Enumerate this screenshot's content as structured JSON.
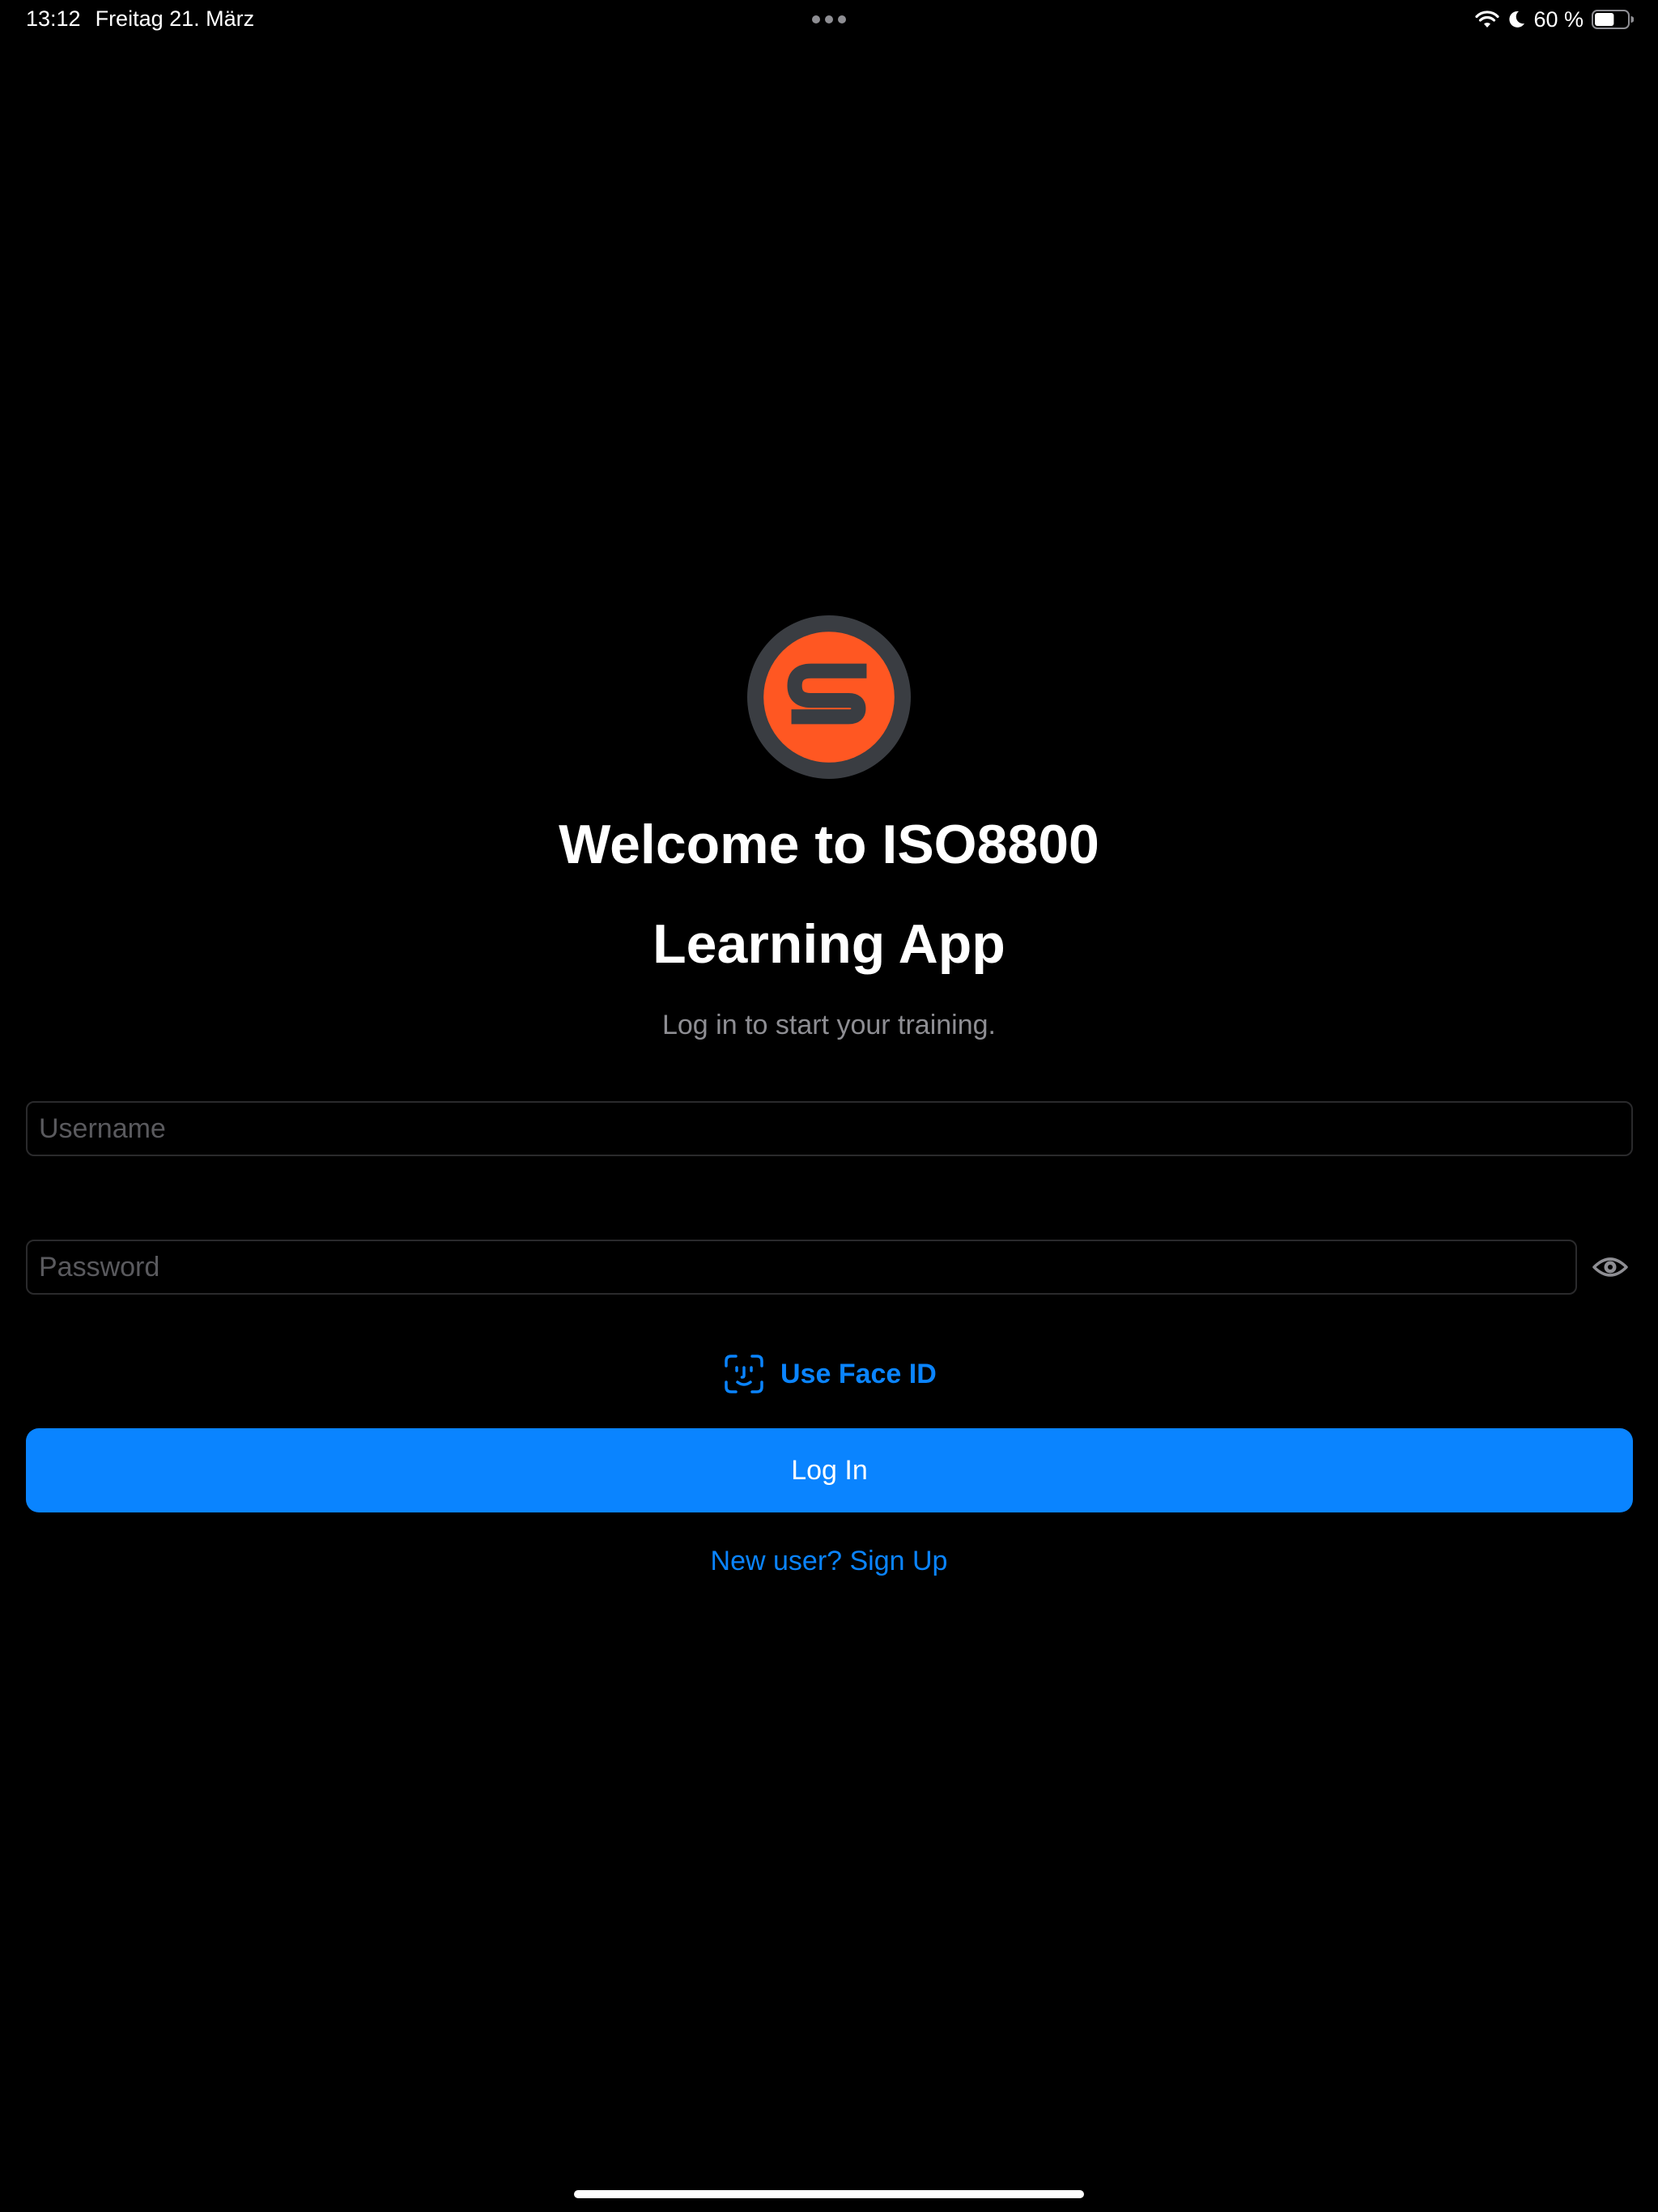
{
  "status_bar": {
    "time": "13:12",
    "date": "Freitag 21. März",
    "battery_percent": "60 %",
    "battery_level": 0.6,
    "icons": [
      "wifi-icon",
      "moon-icon",
      "battery-icon"
    ]
  },
  "logo": {
    "icon": "app-logo-icon",
    "colors": {
      "ring": "#3a3d42",
      "fill": "#ff5722",
      "letter": "#3a3d42"
    }
  },
  "welcome": {
    "title_line1": "Welcome to ISO8800",
    "title_line2": "Learning App",
    "subtitle": "Log in to start your training."
  },
  "form": {
    "username_placeholder": "Username",
    "username_value": "",
    "password_placeholder": "Password",
    "password_value": "",
    "show_password_icon": "eye-icon",
    "face_id_icon": "face-id-icon",
    "face_id_label": "Use Face ID",
    "login_label": "Log In",
    "signup_label": "New user? Sign Up"
  },
  "colors": {
    "background": "#000000",
    "accent": "#0a84ff",
    "secondary_text": "#8e8e93",
    "field_border": "#2a2a2c"
  }
}
